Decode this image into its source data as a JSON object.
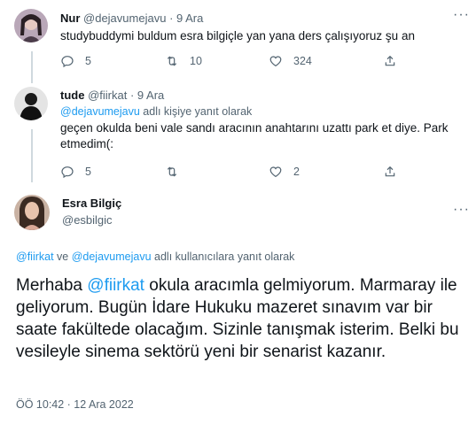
{
  "tweet1": {
    "name": "Nur",
    "handle": "@dejavumejavu",
    "time": "· 9 Ara",
    "text": "studybuddymi buldum esra bilgiçle yan yana ders çalışıyoruz şu an",
    "replies": "5",
    "retweets": "10",
    "likes": "324"
  },
  "tweet2": {
    "name": "tude",
    "handle": "@fiirkat",
    "time": "· 9 Ara",
    "reply_mention": "@dejavumejavu",
    "reply_suffix": " adlı kişiye yanıt olarak",
    "text": "geçen okulda beni vale sandı aracının anahtarını uzattı park et diye. Park etmedim(:",
    "replies": "5",
    "retweets": "",
    "likes": "2"
  },
  "main_tweet": {
    "name": "Esra Bilgiç",
    "handle": "@esbilgic",
    "reply_mention1": "@fiirkat",
    "reply_middle": " ve ",
    "reply_mention2": "@dejavumejavu",
    "reply_suffix": " adlı kullanıcılara yanıt olarak",
    "text_before": "Merhaba ",
    "text_mention": "@fiirkat",
    "text_after": " okula aracımla gelmiyorum. Marmaray ile geliyorum. Bugün İdare Hukuku mazeret sınavım var bir saate fakültede olacağım. Sizinle tanışmak isterim. Belki bu vesileyle sinema sektörü yeni bir senarist kazanır.",
    "timestamp": "ÖÖ 10:42 · 12 Ara 2022"
  },
  "icons": {
    "reply": "reply-icon",
    "retweet": "retweet-icon",
    "like": "heart-icon",
    "share": "share-icon",
    "more": "more-icon"
  },
  "colors": {
    "accent": "#1d9bf0",
    "secondary_text": "#536471",
    "divider": "#cfd9de"
  }
}
